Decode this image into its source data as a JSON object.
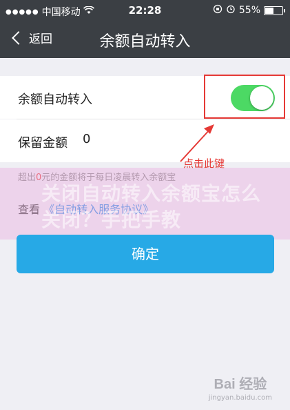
{
  "status_bar": {
    "signal_dots": "●●●●●",
    "carrier": "中国移动",
    "wifi_icon": "wifi-icon",
    "time": "22:28",
    "battery_percent": "55%",
    "battery_level": 0.55
  },
  "nav": {
    "back_label": "返回",
    "title": "余额自动转入"
  },
  "settings": {
    "auto_transfer_label": "余额自动转入",
    "auto_transfer_on": true,
    "reserve_label": "保留金额",
    "reserve_value": "0",
    "hint_prefix": "超出",
    "hint_zero": "0",
    "hint_suffix": "元的金额将于每日凌晨转入余额宝"
  },
  "agreement": {
    "prefix": "查看",
    "link": "《自动转入服务协议》"
  },
  "confirm_label": "确定",
  "annotation": {
    "text": "点击此键",
    "color": "#e53935"
  },
  "watermark": {
    "overlay_text": "关闭自动转入余额宝怎么关闭？手把手教",
    "baidu_logo": "Bai 经验",
    "baidu_url": "jingyan.baidu.com"
  },
  "colors": {
    "toggle_on": "#4cd964",
    "confirm_button": "#27a9e6",
    "nav_bar": "#3b3f44",
    "link": "#2f8de4"
  }
}
